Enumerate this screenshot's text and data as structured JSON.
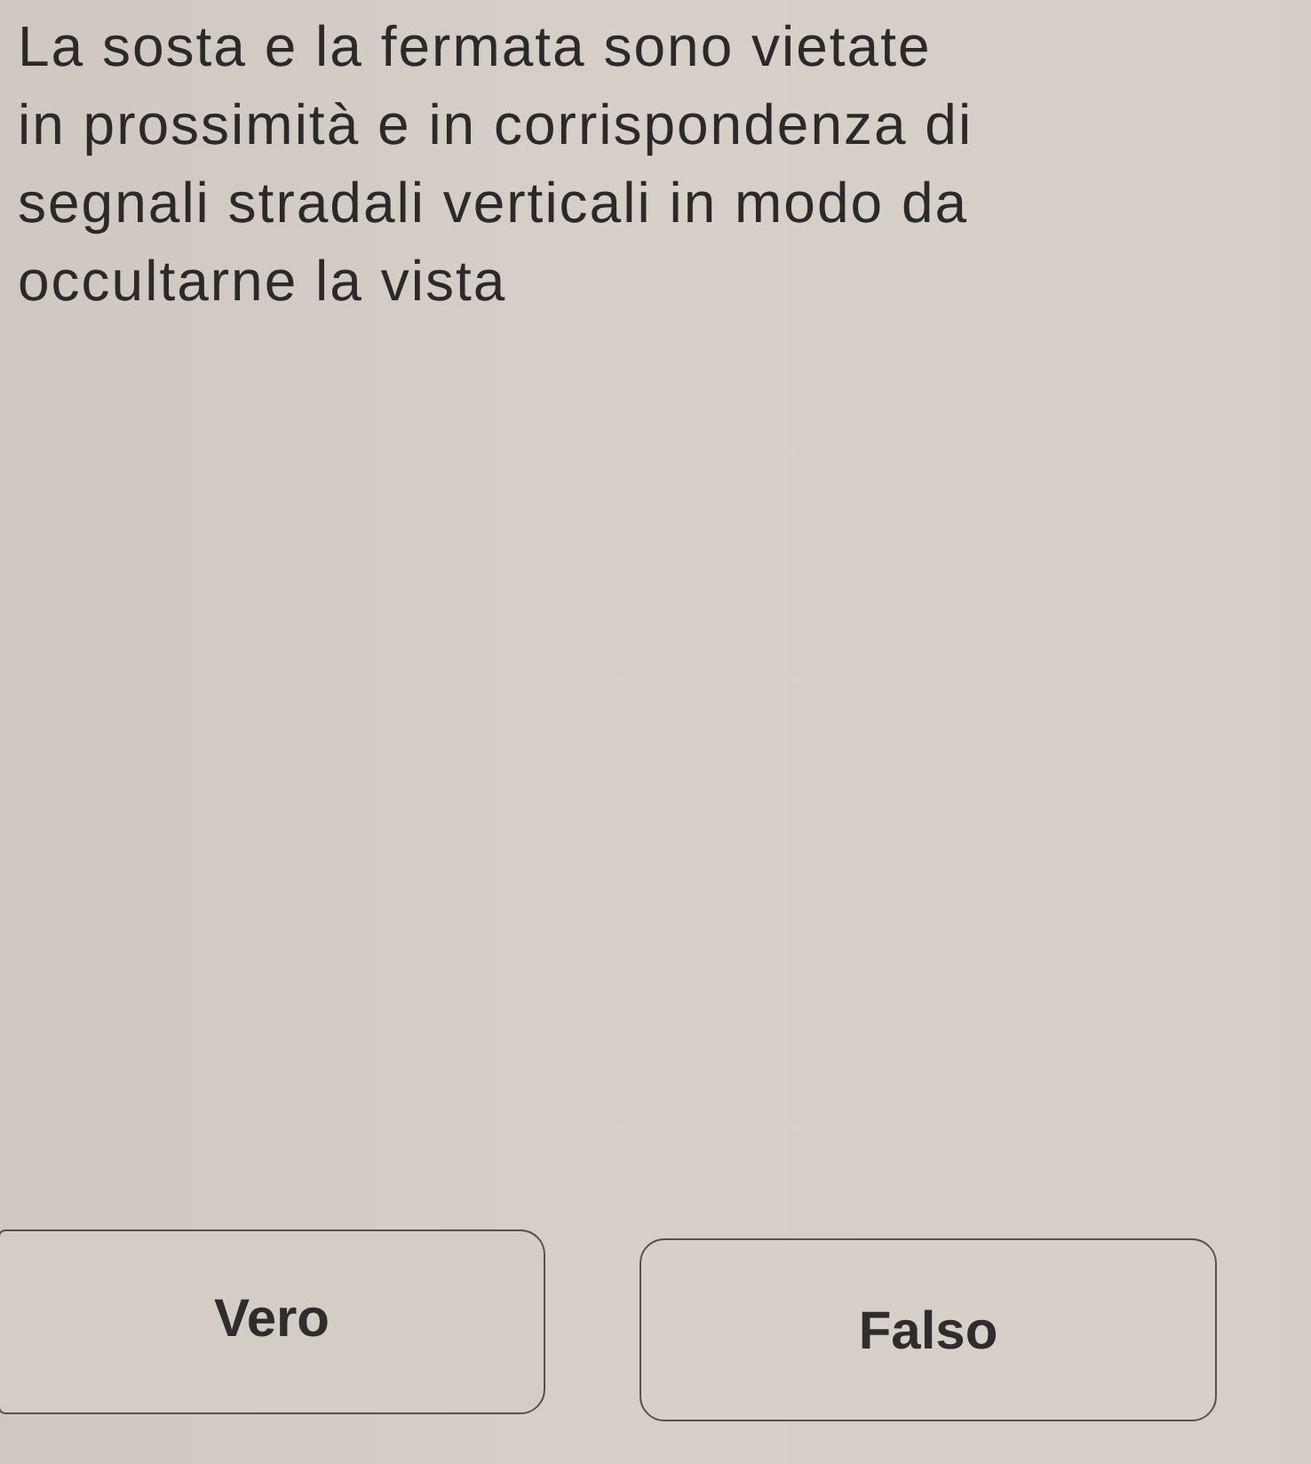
{
  "question": {
    "text": "La sosta e la fermata sono vietate in prossimità e in corrispondenza di segnali stradali verticali in modo da occultarne la vista"
  },
  "answers": [
    {
      "label": "Vero"
    },
    {
      "label": "Falso"
    }
  ]
}
